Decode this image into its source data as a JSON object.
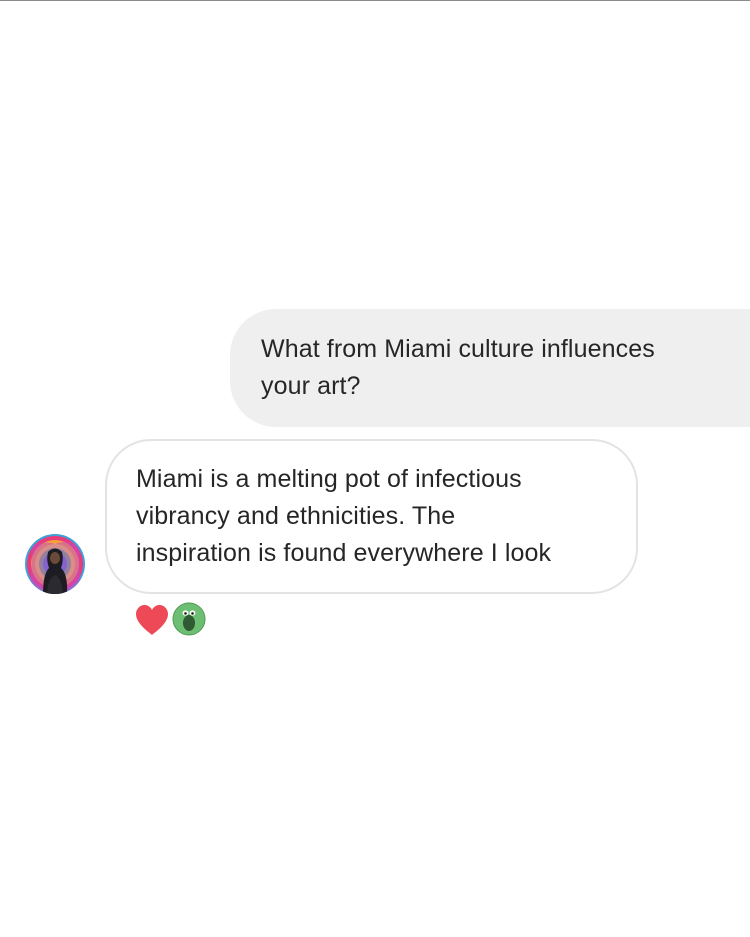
{
  "conversation": {
    "sent_message": {
      "lines": [
        "What from Miami culture influences",
        "your art?"
      ]
    },
    "received_message": {
      "lines": [
        "Miami is a melting pot of infectious",
        "vibrancy and ethnicities. The",
        "inspiration is found everywhere I look"
      ],
      "sender_avatar": "profile-photo-rainbow-ring",
      "reactions": [
        {
          "icon": "red-heart-icon",
          "color": "#ed4956"
        },
        {
          "icon": "green-monster-emoji-icon",
          "color": "#6cbf72"
        }
      ]
    }
  },
  "colors": {
    "sent_bubble": "#efefef",
    "received_border": "#e3e3e3",
    "text": "#262626",
    "heart": "#ed4956"
  }
}
